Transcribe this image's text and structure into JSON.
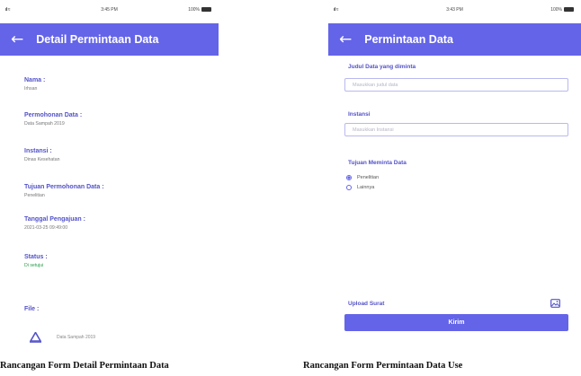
{
  "detail_screen": {
    "status_bar": {
      "signal": "ıl ≈",
      "time": "3:45 PM",
      "battery": "100%"
    },
    "title": "Detail Permintaan Data",
    "back_icon": "arrow-left-icon",
    "fields": [
      {
        "label": "Nama :",
        "value": "Irhsan"
      },
      {
        "label": "Permohonan Data :",
        "value": "Data Sampah 2019"
      },
      {
        "label": "Instansi :",
        "value": "Dinas Kesehatan"
      },
      {
        "label": "Tujuan Permohonan Data :",
        "value": "Penelitian"
      },
      {
        "label": "Tanggal Pengajuan :",
        "value": "2021-03-25 09:49:00"
      },
      {
        "label": "Status :",
        "value": "Di setujui"
      },
      {
        "label": "File :",
        "value": ""
      }
    ],
    "file": {
      "icon": "file-icon",
      "name": "Data Sampah 2019"
    },
    "caption": "Rancangan Form Detail Permintaan Data"
  },
  "request_screen": {
    "status_bar": {
      "signal": "ıl ≈",
      "time": "3:43 PM",
      "battery": "100%"
    },
    "title": "Permintaan Data",
    "back_icon": "arrow-left-icon",
    "judul_label": "Judul Data yang diminta",
    "judul_placeholder": "Masukkan judul data",
    "instansi_label": "Instansi",
    "instansi_placeholder": "Masukkan Instansi",
    "tujuan_label": "Tujuan Meminta Data",
    "options": [
      {
        "label": "Penelitian",
        "checked": true
      },
      {
        "label": "Lainnya",
        "checked": false
      }
    ],
    "upload_label": "Upload Surat",
    "upload_icon": "image-upload-icon",
    "submit_label": "Kirim",
    "caption": "Rancangan Form Permintaan Data Use"
  },
  "colors": {
    "primary": "#6464e9",
    "label": "#5352c9",
    "status_ok": "#2a9d4a"
  }
}
